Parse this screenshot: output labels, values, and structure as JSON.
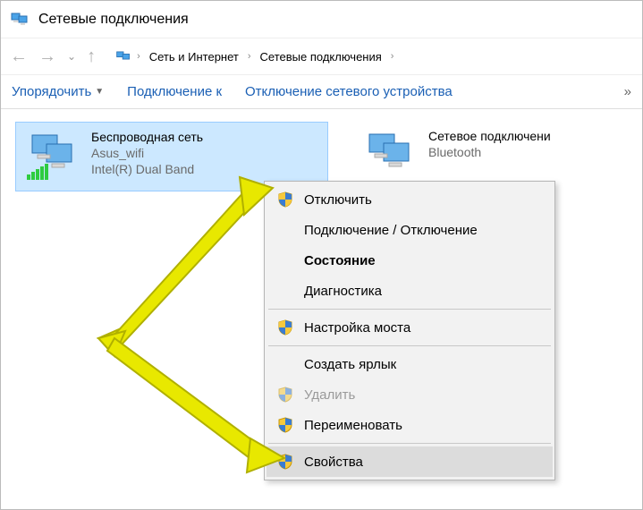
{
  "titlebar": {
    "title": "Сетевые подключения"
  },
  "breadcrumbs": {
    "items": [
      "Сеть и Интернет",
      "Сетевые подключения"
    ]
  },
  "toolbar": {
    "organize": "Упорядочить",
    "connectTo": "Подключение к",
    "disableDevice": "Отключение сетевого устройства",
    "overflow": "»"
  },
  "connections": {
    "wifi": {
      "name": "Беспроводная сеть",
      "ssid": "Asus_wifi",
      "adapter": "Intel(R) Dual Band"
    },
    "bluetooth": {
      "name": "Сетевое подключени",
      "sub": "Bluetooth"
    }
  },
  "contextMenu": {
    "disable": "Отключить",
    "connectDisconnect": "Подключение / Отключение",
    "status": "Состояние",
    "diagnostics": "Диагностика",
    "bridge": "Настройка моста",
    "shortcut": "Создать ярлык",
    "delete": "Удалить",
    "rename": "Переименовать",
    "properties": "Свойства"
  }
}
